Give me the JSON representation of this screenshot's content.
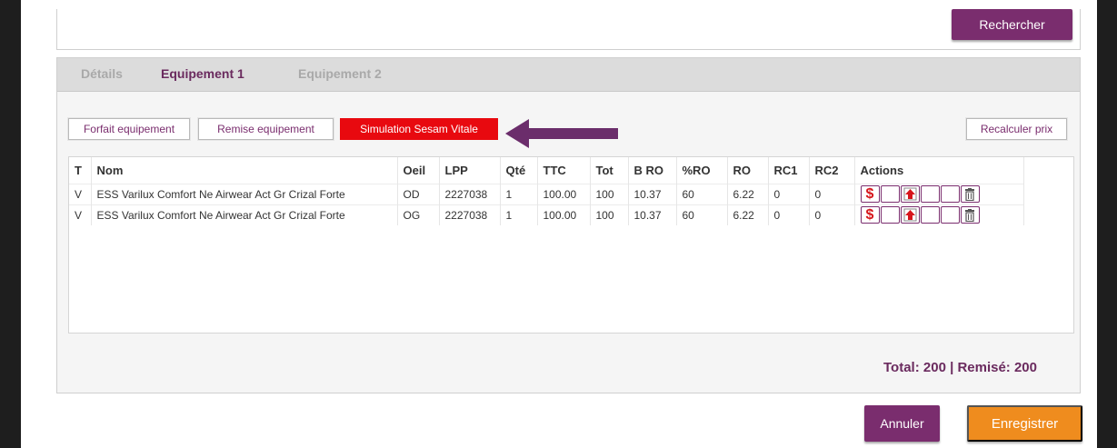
{
  "search": {
    "button_label": "Rechercher"
  },
  "tabs": [
    {
      "label": "Détails"
    },
    {
      "label": "Equipement 1"
    },
    {
      "label": "Equipement 2"
    }
  ],
  "toolbar": {
    "forfait_label": "Forfait equipement",
    "remise_label": "Remise equipement",
    "simulation_label": "Simulation Sesam Vitale",
    "recalc_label": "Recalculer prix"
  },
  "table": {
    "headers": [
      "T",
      "Nom",
      "Oeil",
      "LPP",
      "Qté",
      "TTC",
      "Tot",
      "B RO",
      "%RO",
      "RO",
      "RC1",
      "RC2",
      "Actions"
    ],
    "rows": [
      [
        "V",
        "ESS Varilux Comfort Ne Airwear Act Gr Crizal Forte",
        "OD",
        "2227038",
        "1",
        "100.00",
        "100",
        "10.37",
        "60",
        "6.22",
        "0",
        "0"
      ],
      [
        "V",
        "ESS Varilux Comfort Ne Airwear Act Gr Crizal Forte",
        "OG",
        "2227038",
        "1",
        "100.00",
        "100",
        "10.37",
        "60",
        "6.22",
        "0",
        "0"
      ]
    ],
    "action_icons": [
      "dollar-icon",
      "blank-icon",
      "upload-icon",
      "blank-icon",
      "blank-icon",
      "trash-icon"
    ],
    "dollar_glyph": "$"
  },
  "total": {
    "text": "Total: 200 | Remisé: 200"
  },
  "footer": {
    "cancel_label": "Annuler",
    "save_label": "Enregistrer"
  },
  "colors": {
    "accent": "#7a2d6e",
    "danger": "#e8090f",
    "save": "#ef8c1e"
  }
}
